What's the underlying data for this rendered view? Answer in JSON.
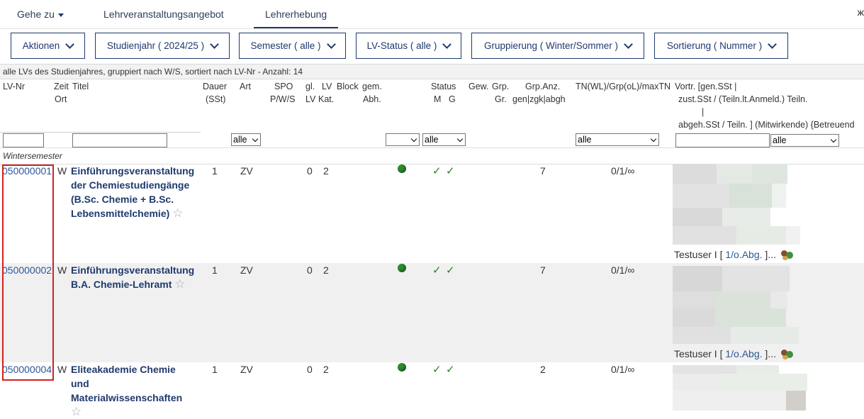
{
  "nav": {
    "goto_label": "Gehe zu",
    "tab_offer": "Lehrveranstaltungsangebot",
    "tab_survey": "Lehrerhebung",
    "edge_glyph": "ж"
  },
  "filters": {
    "actions": "Aktionen",
    "year": "Studienjahr ( 2024/25 )",
    "semester": "Semester ( alle )",
    "status": "LV-Status ( alle )",
    "grouping": "Gruppierung ( Winter/Sommer )",
    "sorting": "Sortierung ( Nummer )"
  },
  "summary": "alle LVs des Studienjahres, gruppiert nach W/S, sortiert nach LV-Nr - Anzahl: 14",
  "headers": {
    "lvnr": "LV-Nr",
    "zeit": "Zeit",
    "ort": "Ort",
    "titel": "Titel",
    "dauer": "Dauer",
    "sst": "(SSt)",
    "art": "Art",
    "spo": "SPO",
    "pws": "P/W/S",
    "gl": "gl.",
    "lv_small": "LV",
    "lv": "LV",
    "kat": "Kat.",
    "block": "Block",
    "gem": "gem.",
    "abh": "Abh.",
    "status": "Status",
    "m": "M",
    "g": "G",
    "gew": "Gew.",
    "grp": "Grp.",
    "gr": "Gr.",
    "grpanz": "Grp.Anz.",
    "grpanz_sub": "gen|zgk|abgh",
    "tn": "TN(WL)/Grp(oL)/maxTN",
    "vortr1": "Vortr. [gen.SSt |",
    "vortr2": "zust.SSt / (Teiln.lt.Anmeld.) Teiln.",
    "vortr3": "|",
    "vortr4": "abgeh.SSt / Teiln. ] (Mitwirkende) {Betreuend"
  },
  "filter_selects": {
    "art": "alle",
    "status": "alle",
    "tn": "alle",
    "vortr": "alle"
  },
  "group_label": "Wintersemester",
  "rows": [
    {
      "lvnr": "050000001",
      "zeit": "W",
      "title_lines": [
        "Einführungsveranstaltung",
        "der Chemiestudiengänge",
        "(B.Sc. Chemie + B.Sc.",
        "Lebensmittelchemie)"
      ],
      "dauer": "1",
      "art": "ZV",
      "gl": "0",
      "kat": "2",
      "grpanz": "7",
      "tn": "0/1/∞",
      "lecturer": "Testuser I [",
      "lecturer_link": "1/o.Abg.",
      "lecturer_end": "]..."
    },
    {
      "lvnr": "050000002",
      "zeit": "W",
      "title_lines": [
        "Einführungsveranstaltung",
        "B.A. Chemie-Lehramt"
      ],
      "dauer": "1",
      "art": "ZV",
      "gl": "0",
      "kat": "2",
      "grpanz": "7",
      "tn": "0/1/∞",
      "lecturer": "Testuser I [",
      "lecturer_link": "1/o.Abg.",
      "lecturer_end": "]..."
    },
    {
      "lvnr": "050000004",
      "zeit": "W",
      "title_lines": [
        "Eliteakademie Chemie",
        "und",
        "Materialwissenschaften"
      ],
      "dauer": "1",
      "art": "ZV",
      "gl": "0",
      "kat": "2",
      "grpanz": "2",
      "tn": "0/1/∞"
    }
  ],
  "icons": {
    "star": "☆",
    "check": "✓",
    "dot": "status-dot-icon"
  }
}
